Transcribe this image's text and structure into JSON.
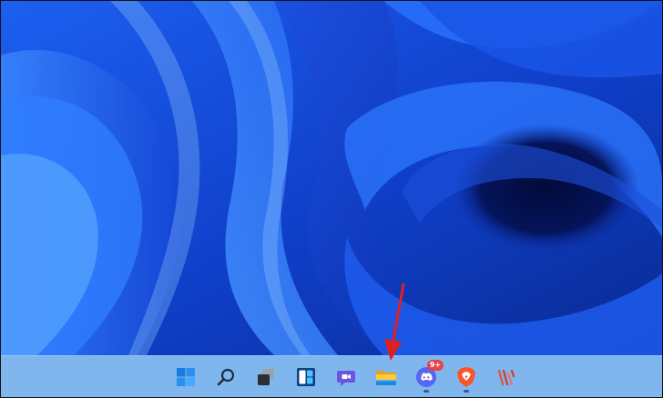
{
  "desktop": {
    "wallpaper": "blue-ribbons-bloom",
    "colors": {
      "wallpaper_dark": "#061a73",
      "wallpaper_mid": "#1448d8",
      "wallpaper_light": "#2f7dff",
      "taskbar": "#7fb6ee",
      "arrow": "#e02020"
    }
  },
  "taskbar": {
    "items": [
      {
        "icon": "start-icon",
        "running": false
      },
      {
        "icon": "search-icon",
        "running": false
      },
      {
        "icon": "task-view-icon",
        "running": false
      },
      {
        "icon": "widgets-icon",
        "running": false
      },
      {
        "icon": "teams-chat-icon",
        "running": false
      },
      {
        "icon": "file-explorer-icon",
        "running": false
      },
      {
        "icon": "discord-icon",
        "running": true,
        "badge": "9+"
      },
      {
        "icon": "brave-icon",
        "running": true
      },
      {
        "icon": "app-icon",
        "running": false
      }
    ]
  },
  "annotation": {
    "type": "arrow",
    "target": "file-explorer-icon"
  }
}
